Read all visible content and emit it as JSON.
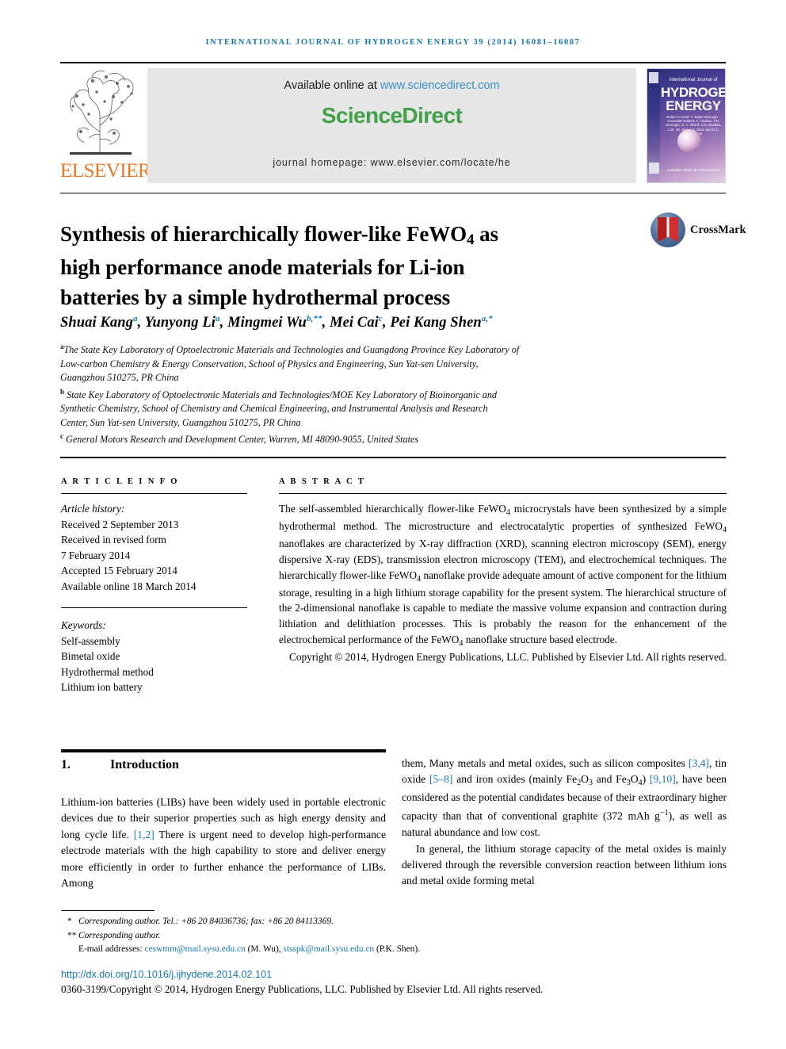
{
  "running_head": "International Journal of Hydrogen Energy 39 (2014) 16081–16087",
  "masthead": {
    "elsevier_wordmark": "ELSEVIER",
    "available_prefix": "Available online at ",
    "available_url": "www.sciencedirect.com",
    "brand": "ScienceDirect",
    "homepage": "journal homepage: www.elsevier.com/locate/he",
    "cover": {
      "top_text": "International Journal of",
      "title_line1": "HYDROGEN",
      "title_line2": "ENERGY",
      "editors": "Editor-in-Chief: T. Nejat Veziroglu  ·  Associate Editors: A. Hudnut, T.N. Veziroglu, S. A. Sherif, A.G. Bruales, L.W. Jin Vitro, I.or. Dincı and D.A. Santangelo",
      "bottom_text": "Available online at ScienceDirect"
    }
  },
  "title": {
    "line1_a": "Synthesis of hierarchically flower-like FeWO",
    "line1_sub": "4",
    "line1_b": " as",
    "line2": "high performance anode materials for Li-ion",
    "line3": "batteries by a simple hydrothermal process"
  },
  "crossmark": {
    "label": "CrossMark"
  },
  "authors": {
    "list": [
      {
        "name": "Shuai Kang",
        "marks": "a"
      },
      {
        "name": "Yunyong Li",
        "marks": "a"
      },
      {
        "name": "Mingmei Wu",
        "marks": "b,**"
      },
      {
        "name": "Mei Cai",
        "marks": "c"
      },
      {
        "name": "Pei Kang Shen",
        "marks": "a,*"
      }
    ],
    "affiliations": [
      {
        "mark": "a",
        "lines": [
          "The State Key Laboratory of Optoelectronic Materials and Technologies and Guangdong Province Key Laboratory of",
          "Low-carbon Chemistry & Energy Conservation, School of Physics and Engineering, Sun Yat-sen University,",
          "Guangzhou 510275, PR China"
        ]
      },
      {
        "mark": "b",
        "lines": [
          "State Key Laboratory of Optoelectronic Materials and Technologies/MOE Key Laboratory of Bioinorganic and",
          "Synthetic Chemistry, School of Chemistry and Chemical Engineering, and Instrumental Analysis and Research",
          "Center, Sun Yat-sen University, Guangzhou 510275, PR China"
        ]
      },
      {
        "mark": "c",
        "lines": [
          "General Motors Research and Development Center, Warren, MI 48090-9055, United States"
        ]
      }
    ]
  },
  "article_info": {
    "heading": "A R T I C L E   I N F O",
    "history_label": "Article history:",
    "history": [
      "Received 2 September 2013",
      "Received in revised form",
      "7 February 2014",
      "Accepted 15 February 2014",
      "Available online 18 March 2014"
    ],
    "keywords_label": "Keywords:",
    "keywords": [
      "Self-assembly",
      "Bimetal oxide",
      "Hydrothermal method",
      "Lithium ion battery"
    ]
  },
  "abstract": {
    "heading": "A B S T R A C T",
    "part1": "The self-assembled hierarchically flower-like FeWO",
    "sub1": "4",
    "part2": " microcrystals have been synthesized by a simple hydrothermal method. The microstructure and electrocatalytic properties of synthesized FeWO",
    "sub2": "4",
    "part3": " nanoflakes are characterized by X-ray diffraction (XRD), scanning electron microscopy (SEM), energy dispersive X-ray (EDS), transmission electron microscopy (TEM), and electrochemical techniques. The hierarchically flower-like FeWO",
    "sub3": "4",
    "part4": " nanoflake provide adequate amount of active component for the lithium storage, resulting in a high lithium storage capability for the present system. The hierarchical structure of the 2-dimensional nanoflake is capable to mediate the massive volume expansion and contraction during lithiation and delithiation processes. This is probably the reason for the enhancement of the electrochemical performance of the FeWO",
    "sub4": "4",
    "part5": " nanoflake structure based electrode.",
    "copyright": "Copyright © 2014, Hydrogen Energy Publications, LLC. Published by Elsevier Ltd. All rights reserved."
  },
  "introduction": {
    "number": "1.",
    "heading": "Introduction",
    "para1_a": "Lithium-ion batteries (LIBs) have been widely used in portable electronic devices due to their superior properties such as high energy density and long cycle life. ",
    "para1_ref1": "[1,2]",
    "para1_b": " There is urgent need to develop high-performance electrode materials with the high capability to store and deliver energy more efficiently in order to further enhance the performance of LIBs. Among them, Many metals and metal oxides, such as silicon composites ",
    "para1_ref2": "[3,4]",
    "para1_c": ", tin oxide ",
    "para1_ref3": "[5–8]",
    "para1_d": " and iron oxides (mainly Fe",
    "para1_sub1": "2",
    "para1_e": "O",
    "para1_sub2": "3",
    "para1_f": " and Fe",
    "para1_sub3": "3",
    "para1_g": "O",
    "para1_sub4": "4",
    "para1_h": ") ",
    "para1_ref4": "[9,10]",
    "para1_i": ", have been considered as the potential candidates because of their extraordinary higher capacity than that of conventional graphite (372 mAh g",
    "para1_sup1": "−1",
    "para1_j": "), as well as natural abundance and low cost.",
    "para2": "In general, the lithium storage capacity of the metal oxides is mainly delivered through the reversible conversion reaction between lithium ions and metal oxide forming metal"
  },
  "footnotes": {
    "fn1_mark": "*",
    "fn1_text": "Corresponding author. Tel.: +86 20 84036736; fax: +86 20 84113369.",
    "fn2_mark": "**",
    "fn2_text": "Corresponding author.",
    "emails_label": "E-mail addresses: ",
    "email1": "ceswmm@mail.sysu.edu.cn",
    "email1_owner": " (M. Wu), ",
    "email2": "stsspk@mail.sysu.edu.cn",
    "email2_owner": " (P.K. Shen)."
  },
  "doi": "http://dx.doi.org/10.1016/j.ijhydene.2014.02.101",
  "issn_copyright": "0360-3199/Copyright © 2014, Hydrogen Energy Publications, LLC. Published by Elsevier Ltd. All rights reserved.",
  "colors": {
    "link_blue": "#1878a8",
    "sd_green": "#41a048",
    "elsevier_orange": "#e87722",
    "sd_url_blue": "#3a8fc4"
  }
}
